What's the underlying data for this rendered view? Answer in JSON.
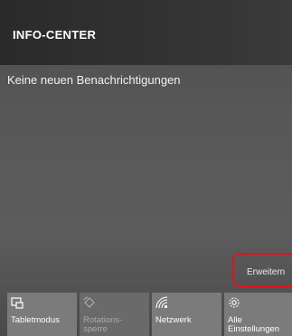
{
  "header": {
    "title": "INFO-CENTER"
  },
  "notifications": {
    "empty_message": "Keine neuen Benachrichtigungen"
  },
  "expand": {
    "label": "Erweitern"
  },
  "quick_actions": [
    {
      "label": "Tabletmodus",
      "icon": "tablet-mode-icon",
      "enabled": true
    },
    {
      "label": "Rotations-\nsperre",
      "icon": "rotation-lock-icon",
      "enabled": false
    },
    {
      "label": "Netzwerk",
      "icon": "network-icon",
      "enabled": true
    },
    {
      "label": "Alle\nEinstellungen",
      "icon": "gear-icon",
      "enabled": true
    }
  ],
  "colors": {
    "highlight": "#e0131f"
  }
}
